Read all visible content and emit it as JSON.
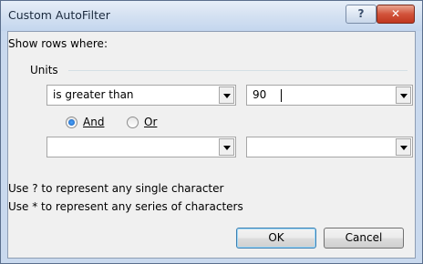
{
  "window": {
    "title": "Custom AutoFilter",
    "help_label": "?",
    "close_label": "✕"
  },
  "dialog": {
    "show_rows_label": "Show rows where:",
    "field_name": "Units",
    "criteria1": {
      "operator": "is greater than",
      "value": "90"
    },
    "logic": {
      "and_label": "And",
      "or_label": "Or",
      "selected": "And"
    },
    "criteria2": {
      "operator": "",
      "value": ""
    },
    "hint1": "Use ? to represent any single character",
    "hint2": "Use * to represent any series of characters"
  },
  "buttons": {
    "ok": "OK",
    "cancel": "Cancel"
  },
  "icons": {
    "help": "help-icon",
    "close": "close-icon",
    "dropdown": "chevron-down-icon"
  }
}
